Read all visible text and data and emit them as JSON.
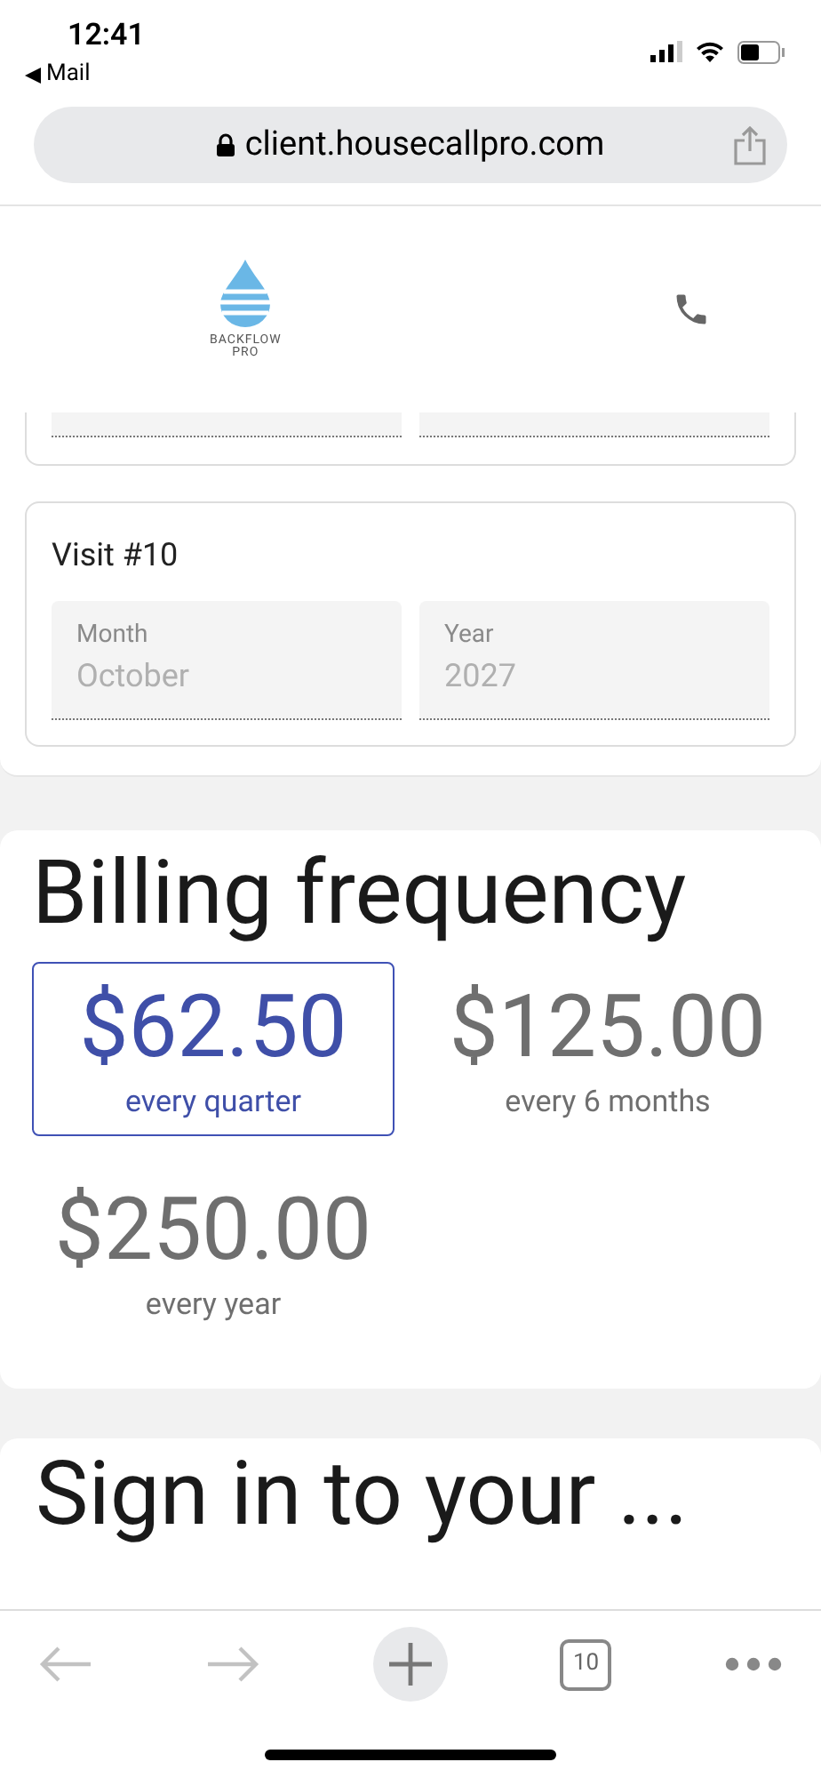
{
  "status_bar": {
    "time": "12:41",
    "back_app": "Mail"
  },
  "browser": {
    "url": "client.housecallpro.com",
    "tab_count": "10"
  },
  "header": {
    "logo_text": [
      "BACKFLOW",
      "PRO"
    ]
  },
  "visit": {
    "title": "Visit #10",
    "fields": [
      {
        "label": "Month",
        "value": "October"
      },
      {
        "label": "Year",
        "value": "2027"
      }
    ]
  },
  "billing": {
    "title": "Billing frequency",
    "options": [
      {
        "price": "$62.50",
        "period": "every quarter",
        "selected": true
      },
      {
        "price": "$125.00",
        "period": "every 6 months",
        "selected": false
      },
      {
        "price": "$250.00",
        "period": "every year",
        "selected": false
      }
    ]
  },
  "sign_in": {
    "title": "Sign in to your ..."
  }
}
